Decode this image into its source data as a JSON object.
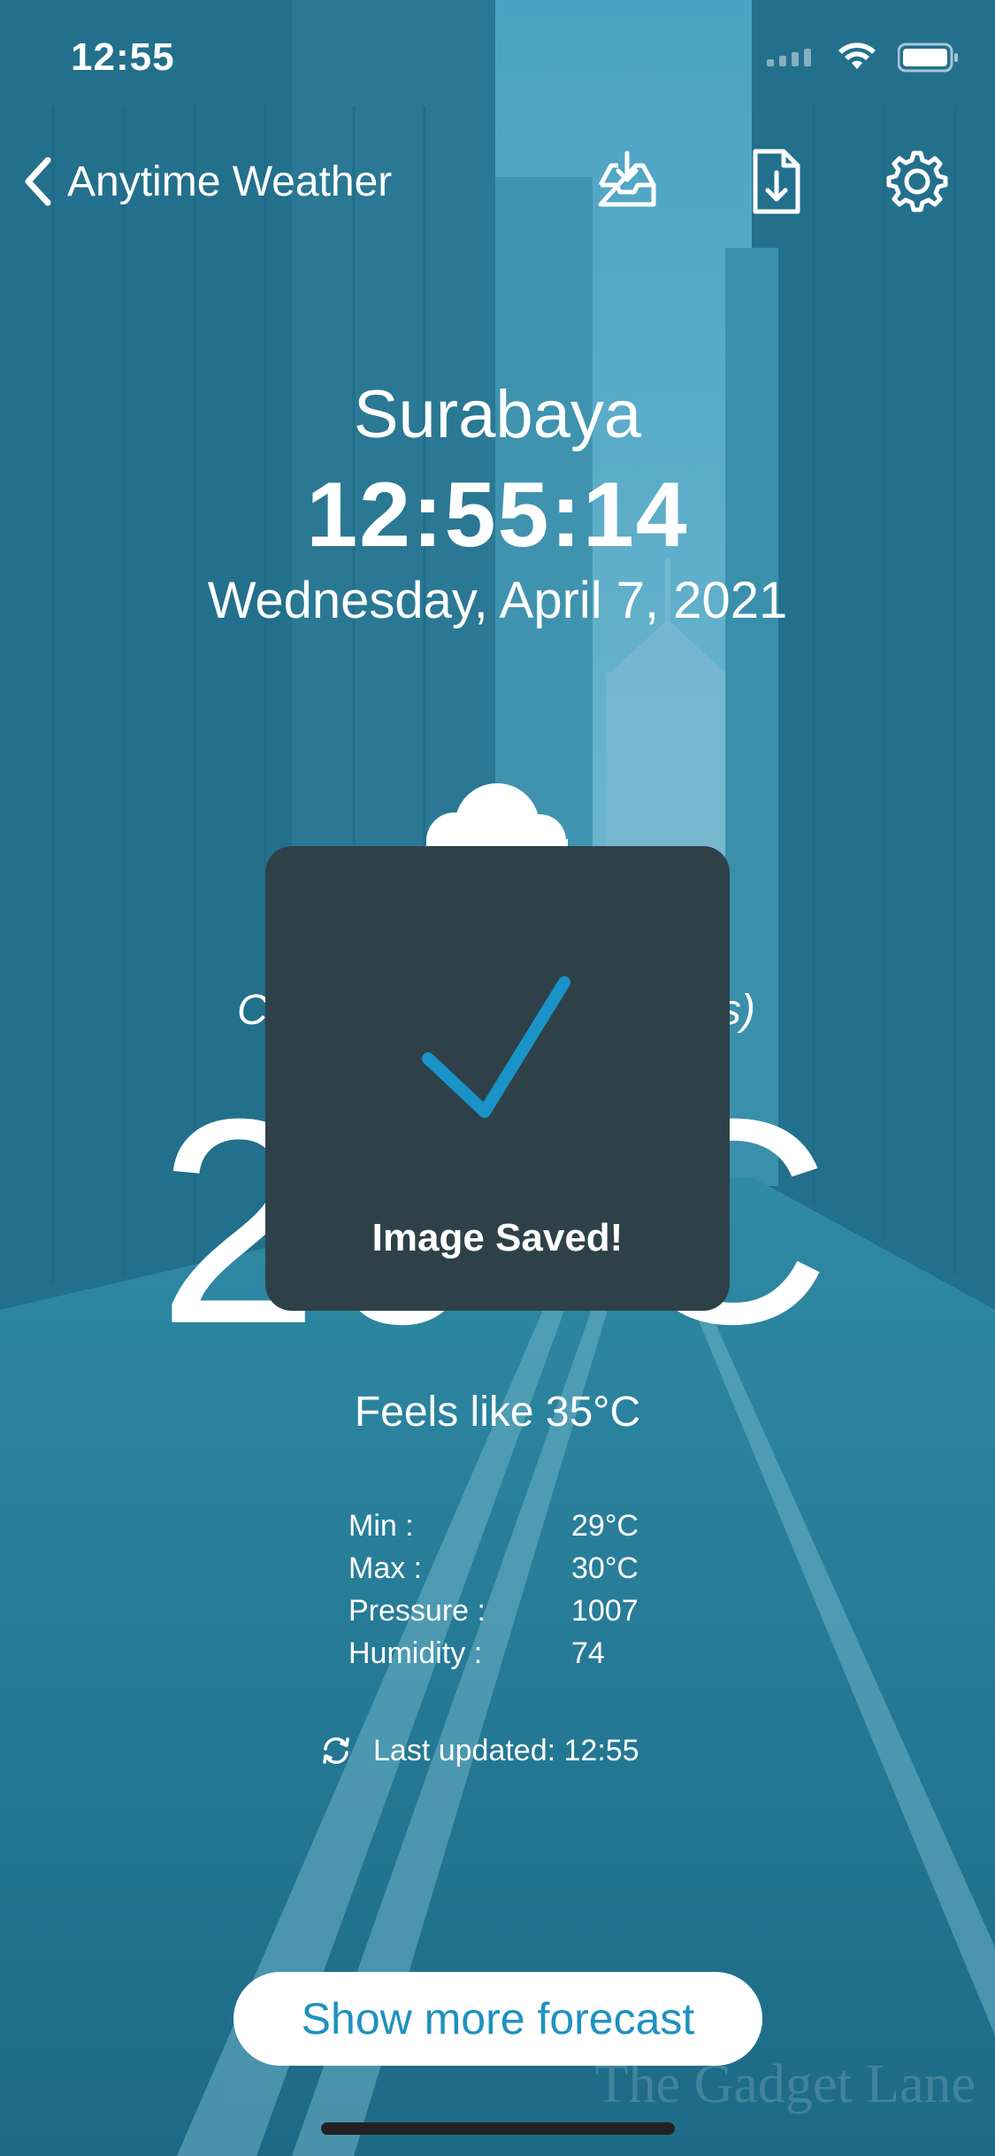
{
  "status_bar": {
    "time": "12:55"
  },
  "nav": {
    "back_label": "Anytime Weather",
    "icons": [
      "inbox-download-icon",
      "file-download-icon",
      "gear-icon"
    ]
  },
  "weather": {
    "city": "Surabaya",
    "clock": "12:55:14",
    "date": "Wednesday, April 7, 2021",
    "condition_left": "C",
    "condition_right": "s)",
    "temperature": "29°C",
    "feels_like": "Feels like 35°C",
    "details": [
      {
        "label": "Min :",
        "value": "29°C"
      },
      {
        "label": "Max :",
        "value": "30°C"
      },
      {
        "label": "Pressure :",
        "value": "1007"
      },
      {
        "label": "Humidity :",
        "value": "74"
      }
    ],
    "last_updated": "Last updated: 12:55"
  },
  "forecast_button": {
    "label": "Show more forecast"
  },
  "toast": {
    "message": "Image Saved!"
  },
  "watermark": "The Gadget Lane",
  "colors": {
    "background_tint": "#2a7f9a",
    "toast_bg": "#2e4149",
    "check_color": "#1a94c8",
    "button_text": "#1f91c0"
  }
}
